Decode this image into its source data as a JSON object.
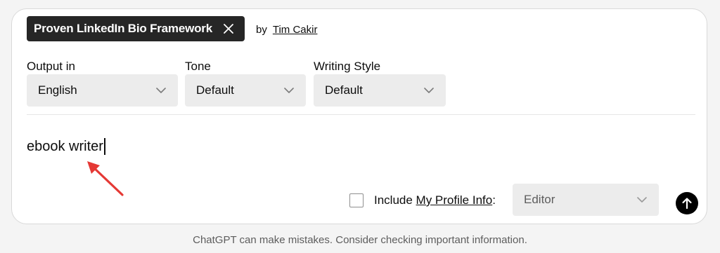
{
  "prompt_template": {
    "name": "Proven LinkedIn Bio Framework",
    "by_label": "by",
    "author": "Tim Cakir"
  },
  "settings": {
    "output": {
      "label": "Output in",
      "value": "English"
    },
    "tone": {
      "label": "Tone",
      "value": "Default"
    },
    "style": {
      "label": "Writing Style",
      "value": "Default"
    }
  },
  "input": {
    "text": "ebook writer"
  },
  "profile": {
    "include_prefix": "Include ",
    "link_text": "My Profile Info",
    "suffix": ":",
    "checked": false,
    "select_value": "Editor"
  },
  "annotation": {
    "arrow_color": "#e53935"
  },
  "footer": {
    "disclaimer": "ChatGPT can make mistakes. Consider checking important information."
  },
  "icons": {
    "chip_close": "close-icon",
    "dropdown": "chevron-down-icon",
    "send": "arrow-up-icon"
  }
}
